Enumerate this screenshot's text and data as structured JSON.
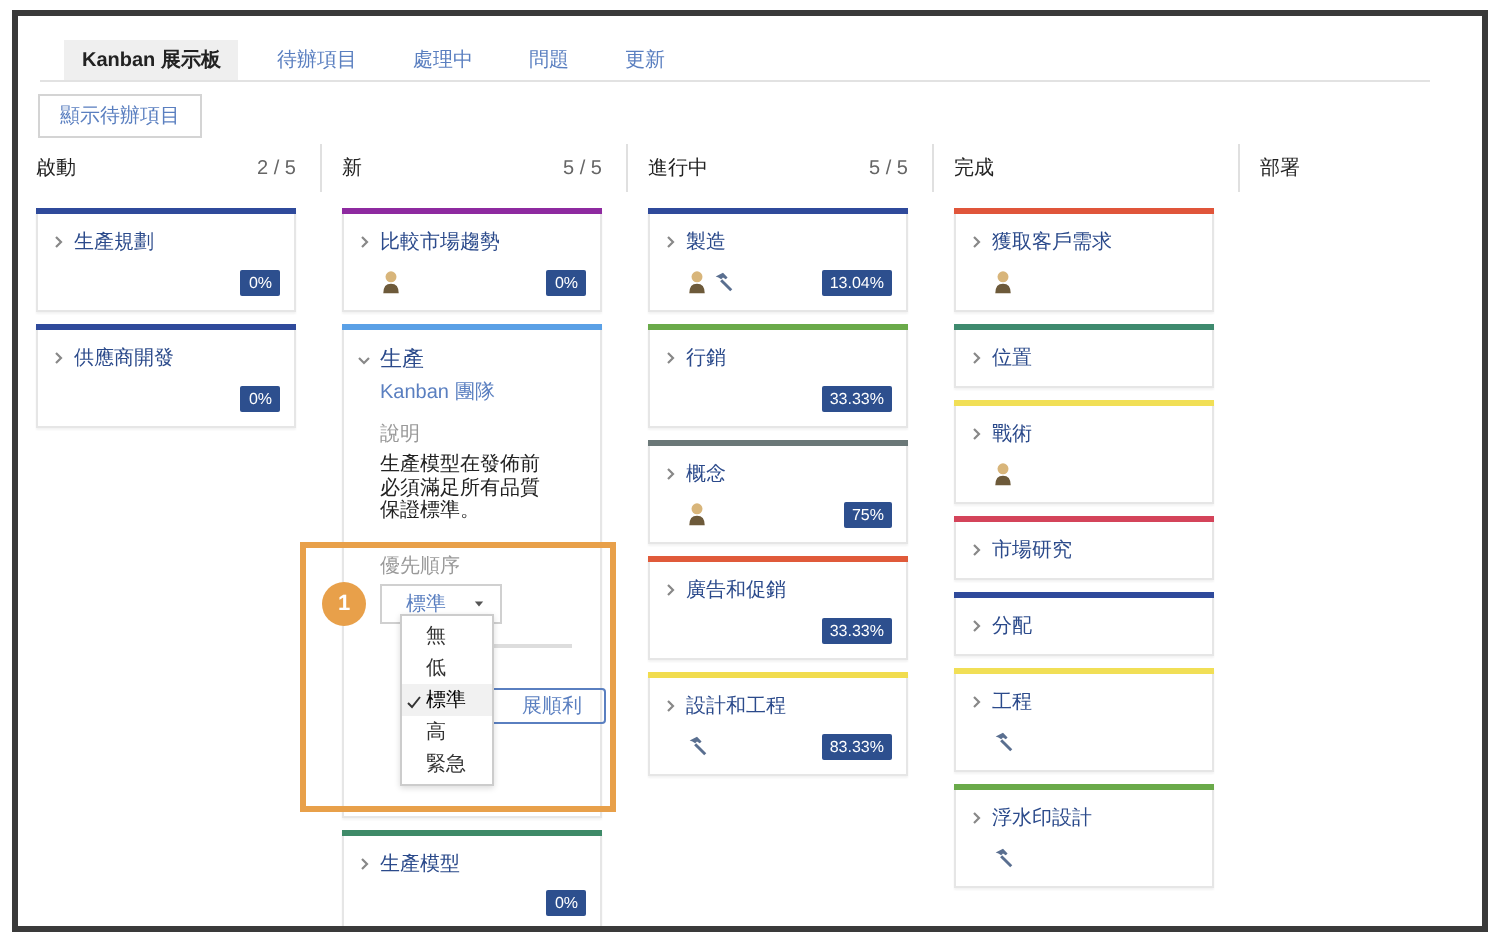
{
  "tabs": [
    {
      "label": "Kanban 展示板",
      "selected": true
    },
    {
      "label": "待辦項目",
      "selected": false
    },
    {
      "label": "處理中",
      "selected": false
    },
    {
      "label": "問題",
      "selected": false
    },
    {
      "label": "更新",
      "selected": false
    }
  ],
  "backlog_button": "顯示待辦項目",
  "columns": [
    {
      "name": "啟動",
      "count": "2 / 5",
      "cards": [
        {
          "title": "生產規劃",
          "color": "#2f4a9b",
          "expanded": false,
          "progress": "0%"
        },
        {
          "title": "供應商開發",
          "color": "#2f4a9b",
          "expanded": false,
          "progress": "0%"
        }
      ]
    },
    {
      "name": "新",
      "count": "5 / 5",
      "cards": [
        {
          "title": "比較市場趨勢",
          "color": "#8e2aa0",
          "expanded": false,
          "icons": [
            {
              "kind": "person"
            }
          ],
          "progress": "0%"
        },
        {
          "title": "生產",
          "color": "#5aa0e6",
          "expanded": true,
          "team": "Kanban 團隊",
          "description_label": "說明",
          "description": "生產模型在發佈前必須滿足所有品質保證標準。",
          "priority": {
            "label": "優先順序",
            "value": "標準",
            "options": [
              {
                "label": "無",
                "selected": false
              },
              {
                "label": "低",
                "selected": false
              },
              {
                "label": "標準",
                "selected": true
              },
              {
                "label": "高",
                "selected": false
              },
              {
                "label": "緊急",
                "selected": false
              }
            ]
          },
          "field_value": "展順利"
        },
        {
          "title": "生產模型",
          "color": "#3e8a68",
          "expanded": false,
          "progress": "0%"
        }
      ]
    },
    {
      "name": "進行中",
      "count": "5 / 5",
      "cards": [
        {
          "title": "製造",
          "color": "#2f4a9b",
          "expanded": false,
          "icons": [
            {
              "kind": "person"
            },
            {
              "kind": "hammer"
            }
          ],
          "progress": "13.04%"
        },
        {
          "title": "行銷",
          "color": "#6aaa4a",
          "expanded": false,
          "progress": "33.33%"
        },
        {
          "title": "概念",
          "color": "#6b7878",
          "expanded": false,
          "icons": [
            {
              "kind": "person"
            }
          ],
          "progress": "75%"
        },
        {
          "title": "廣告和促銷",
          "color": "#e05a3a",
          "expanded": false,
          "progress": "33.33%"
        },
        {
          "title": "設計和工程",
          "color": "#f1dc4e",
          "expanded": false,
          "icons": [
            {
              "kind": "hammer"
            }
          ],
          "progress": "83.33%"
        }
      ]
    },
    {
      "name": "完成",
      "cards": [
        {
          "title": "獲取客戶需求",
          "color": "#e0553a",
          "expanded": false,
          "icons": [
            {
              "kind": "person"
            }
          ]
        },
        {
          "title": "位置",
          "color": "#3e8a6e",
          "expanded": false
        },
        {
          "title": "戰術",
          "color": "#f1df56",
          "expanded": false,
          "icons": [
            {
              "kind": "person"
            }
          ]
        },
        {
          "title": "市場研究",
          "color": "#d4445a",
          "expanded": false
        },
        {
          "title": "分配",
          "color": "#2f4a9b",
          "expanded": false
        },
        {
          "title": "工程",
          "color": "#f1df56",
          "expanded": false,
          "icons": [
            {
              "kind": "hammer"
            }
          ]
        },
        {
          "title": "浮水印設計",
          "color": "#6aaa4a",
          "expanded": false,
          "icons": [
            {
              "kind": "hammer"
            }
          ]
        }
      ]
    },
    {
      "name": "部署"
    }
  ],
  "annotation": {
    "callout": "1"
  }
}
